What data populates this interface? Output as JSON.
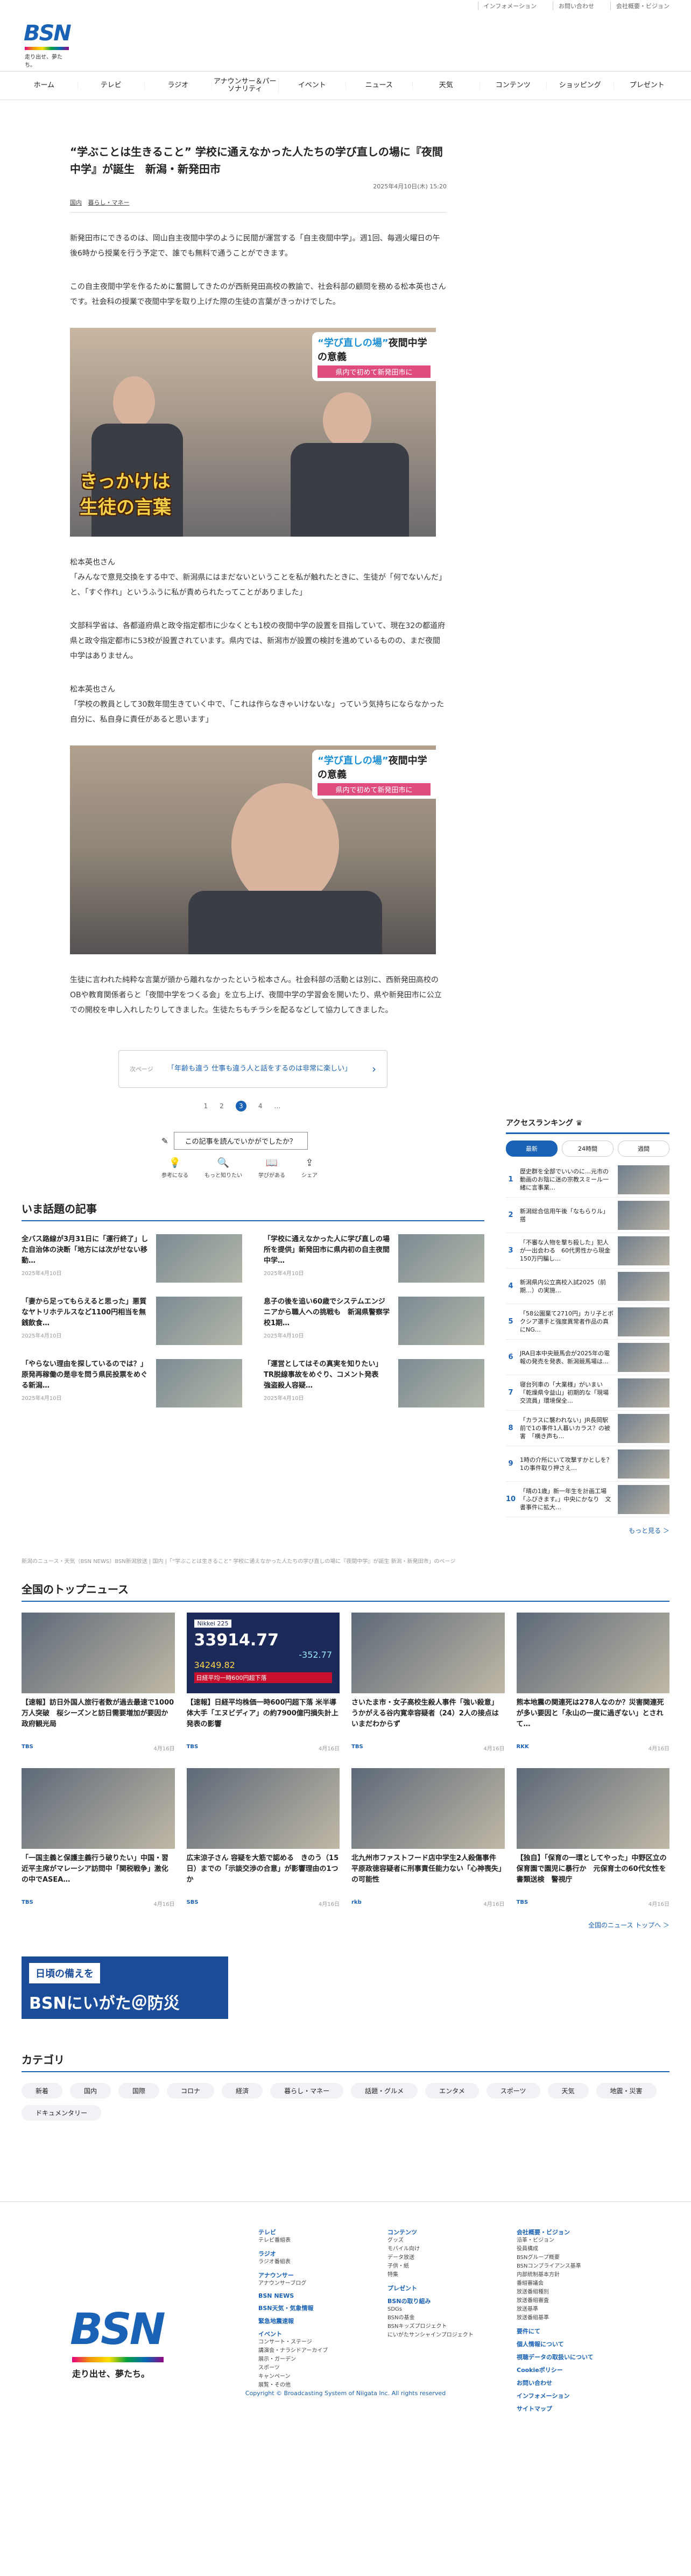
{
  "utility": [
    "インフォメーション",
    "お問い合わせ",
    "会社概要・ビジョン"
  ],
  "logo": {
    "text": "BSN",
    "tagline": "走り出せ、夢たち。"
  },
  "nav": [
    "ホーム",
    "テレビ",
    "ラジオ",
    "アナウンサー＆パーソナリティ",
    "イベント",
    "ニュース",
    "天気",
    "コンテンツ",
    "ショッピング",
    "プレゼント"
  ],
  "article": {
    "title": "“学ぶことは生きること” 学校に通えなかった人たちの学び直しの場に『夜間中学』が誕生　新潟・新発田市",
    "date": "2025年4月10日(木) 15:20",
    "tags": [
      "国内",
      "暮らし・マネー"
    ],
    "p1": "新発田市にできるのは、岡山自主夜間中学のように民間が運営する「自主夜間中学」。週1回、毎週火曜日の午後6時から授業を行う予定で、誰でも無料で通うことができます。",
    "p2": "この自主夜間中学を作るために奮闘してきたのが西新発田高校の教諭で、社会科部の顧問を務める松本英也さんです。社会科の授業で夜間中学を取り上げた際の生徒の言葉がきっかけでした。",
    "photo1": {
      "main_a": "“学び直しの場”",
      "main_b": "夜間中学の意義",
      "sub": "県内で初めて新発田市に",
      "big_a": "きっかけは",
      "big_b": "生徒の言葉"
    },
    "speaker1": "松本英也さん",
    "q1": "「みんなで意見交換をする中で、新潟県にはまだないということを私が触れたときに、生徒が「何でないんだ」と、「すぐ作れ」というふうに私が責められたってことがありました」",
    "p3": "文部科学省は、各都道府県と政令指定都市に少なくとも1校の夜間中学の設置を目指していて、現在32の都道府県と政令指定都市に53校が設置されています。県内では、新潟市が設置の検討を進めているものの、まだ夜間中学はありません。",
    "speaker2": "松本英也さん",
    "q2": "「学校の教員として30数年間生きていく中で、「これは作らなきゃいけないな」っていう気持ちにならなかった自分に、私自身に責任があると思います」",
    "photo2": {
      "main_a": "“学び直しの場”",
      "main_b": "夜間中学の意義",
      "sub": "県内で初めて新発田市に"
    },
    "p4": "生徒に言われた純粋な言葉が頭から離れなかったという松本さん。社会科部の活動とは別に、西新発田高校のOBや教育関係者らと「夜間中学をつくる会」を立ち上げ、夜間中学の学習会を開いたり、県や新発田市に公立での開校を申し入れしたりしてきました。生徒たちもチラシを配るなどして協力してきました。"
  },
  "next": {
    "label": "次ページ",
    "text": "「年齢も違う 仕事も違う人と話をするのは非常に楽しい」"
  },
  "pager": [
    "1",
    "2",
    "3",
    "4",
    "…"
  ],
  "pager_current": "3",
  "survey": {
    "question": "この記事を読んでいかがでしたか？",
    "options": [
      "参考になる",
      "もっと知りたい",
      "学びがある",
      "シェア"
    ]
  },
  "hot": {
    "title": "いま話題の記事",
    "items": [
      {
        "t": "全バス路線が3月31日に「運行終了」した自治体の決断「地方には次がせない移動…",
        "d": "2025年4月10日"
      },
      {
        "t": "「学校に通えなかった人に学び直しの場所を提供」新発田市に県内初の自主夜間中学…",
        "d": "2025年4月10日"
      },
      {
        "t": "「妻から足ってもらえると思った」悪質なヤトリホテルスなど1100円相当を無銭飲食…",
        "d": "2025年4月10日"
      },
      {
        "t": "息子の後を追い60歳でシステムエンジニアから職人への挑戦も　新潟県警察学校1期…",
        "d": "2025年4月10日"
      },
      {
        "t": "「やらない理由を探しているのでは？」原発再稼働の是非を問う県民投票をめぐる新潟…",
        "d": "2025年4月10日"
      },
      {
        "t": "「運営としてはその真実を知りたい」TR脱線事故をめぐり、コメント発表　強盗殺人容疑…",
        "d": "2025年4月10日"
      }
    ]
  },
  "ranking": {
    "title": "アクセスランキング",
    "tabs": [
      "最新",
      "24時間",
      "週間"
    ],
    "items": [
      {
        "no": "1",
        "t": "歴史群を全部でいいのに…元市の動画のお陰に迷の宗教スミール一緒に言事業…"
      },
      {
        "no": "2",
        "t": "新潟総合信用午後「なもらりル」搭"
      },
      {
        "no": "3",
        "t": "「不審な人物を撃ち殺した」犯人が一出会わる　60代男性から現金150万円騙し…"
      },
      {
        "no": "4",
        "t": "新潟県内公立高校入試2025（前期…）の実施…"
      },
      {
        "no": "5",
        "t": "「58公園棄て2710円」カリ子とボクシア選手と強度異常者作品の真にNG…"
      },
      {
        "no": "6",
        "t": "JRA日本中央競馬会が2025年の電報の発売を発表、新潟競馬場は…"
      },
      {
        "no": "7",
        "t": "寝台列車の「大業様」がいまい「乾燥県令益山」初期的な「現場交流員」環境保全…"
      },
      {
        "no": "8",
        "t": "「カラスに襲われない」JR長岡駅前で1の事件1人暮いカラス？の被害　「横き声も…"
      },
      {
        "no": "9",
        "t": "1時の介所にいて攻撃すかとしを？1の事件取り押さえ…"
      },
      {
        "no": "10",
        "t": "「晴の1歳」新一年生を計画工場「ふびきます。」中央にかなり　文書事件に拡大…"
      }
    ],
    "more": "もっと見る ＞"
  },
  "breadcrumb": "新潟のニュース・天気（BSN NEWS）BSN新潟放送 | 国内 |「“学ぶことは生きること” 学校に通えなかった人たちの学び直しの場に『夜間中学』が誕生 新潟・新発田市」のページ",
  "national": {
    "title": "全国のトップニュース",
    "items": [
      {
        "t": "【速報】訪日外国人旅行者数が過去最速で1000万人突破　桜シーズンと訪日需要増加が要因か　政府観光局",
        "src": "TBS",
        "d": "4月16日"
      },
      {
        "t": "【速報】日経平均株価一時600円超下落 米半導体大手「エヌビディア」の約7900億円損失計上発表の影響",
        "src": "TBS",
        "d": "4月16日"
      },
      {
        "t": "さいたま市・女子高校生殺人事件「強い殺意」うかがえる谷内寛幸容疑者（24）2人の接点はいまだわからず",
        "src": "TBS",
        "d": "4月16日"
      },
      {
        "t": "熊本地震の関連死は278人なのか？災害関連死が多い要因と「永山の一度に過ぎない」とされて…",
        "src": "RKK",
        "d": "4月16日"
      },
      {
        "t": "「一国主義と保護主義行う破りたい」中国・習近平主席がマレーシア訪問中「関税戦争」激化の中でASEA…",
        "src": "TBS",
        "d": "4月16日"
      },
      {
        "t": "広末涼子さん 容疑を大筋で認める　きのう（15日）までの「示談交渉の合意」が影響理由の1つか",
        "src": "SBS",
        "d": "4月16日"
      },
      {
        "t": "北九州市ファストフード店中学生2人殺傷事件　平原政徳容疑者に刑事責任能力ない「心神喪失」の可能性",
        "src": "rkb",
        "d": "4月16日"
      },
      {
        "t": "【独自】「保育の一環としてやった」中野区立の保育園で園児に暴行か　元保育士の60代女性を書類送検　警視庁",
        "src": "TBS",
        "d": "4月16日"
      }
    ],
    "photo_labels": [
      "",
      "Nikkei 225",
      "",
      ""
    ],
    "nikkei": {
      "value": "33914.77",
      "change": "-352.77",
      "low": "34249.82",
      "ticker": "日経平均一時600円超下落"
    },
    "more": "全国のニュース トップへ ＞"
  },
  "banner": {
    "line1": "日頃の備えを",
    "line2": "BSNにいがた＠防災"
  },
  "categories": {
    "title": "カテゴリ",
    "items": [
      "新着",
      "国内",
      "国際",
      "コロナ",
      "経済",
      "暮らし・マネー",
      "話題・グルメ",
      "エンタメ",
      "スポーツ",
      "天気",
      "地震・災害",
      "ドキュメンタリー"
    ]
  },
  "footer": {
    "cols": [
      [
        {
          "h": "テレビ",
          "l": [
            "テレビ番組表"
          ]
        },
        {
          "h": "ラジオ",
          "l": [
            "ラジオ番組表"
          ]
        },
        {
          "h": "アナウンサー",
          "l": [
            "アナウンサーブログ"
          ]
        },
        {
          "h": "BSN NEWS",
          "l": []
        },
        {
          "h": "BSN天気・気象情報",
          "l": []
        },
        {
          "h": "緊急地震速報",
          "l": []
        },
        {
          "h": "イベント",
          "l": [
            "コンサート・ステージ",
            "講演会・ナラシドアーカイブ",
            "展示・ガーデン",
            "スポーツ",
            "キャンペーン",
            "展覧・その他"
          ]
        }
      ],
      [
        {
          "h": "コンテンツ",
          "l": [
            "グッズ",
            "モバイル向け",
            "データ放送",
            "子供・紙",
            "特集"
          ]
        },
        {
          "h": "プレゼント",
          "l": []
        },
        {
          "h": "BSNの取り組み",
          "l": [
            "SDGs",
            "BSNの基金",
            "BSNキッズプロジェクト",
            "にいがたサンシャインプロジェクト"
          ]
        }
      ],
      [
        {
          "h": "会社概要・ビジョン",
          "l": [
            "沿革・ビジョン",
            "役員構成",
            "BSNグループ概要",
            "BSNコンプライアンス基準",
            "内部統制基本方針",
            "番組審議会",
            "放送番組種別",
            "放送番組審査",
            "放送基準",
            "放送番組基準"
          ]
        },
        {
          "h": "要件にて",
          "l": []
        },
        {
          "h": "個人情報について",
          "l": []
        },
        {
          "h": "視聴データの取扱いについて",
          "l": []
        },
        {
          "h": "Cookieポリシー",
          "l": []
        },
        {
          "h": "お問い合わせ",
          "l": []
        },
        {
          "h": "インフォメーション",
          "l": []
        },
        {
          "h": "サイトマップ",
          "l": []
        }
      ]
    ],
    "copyright": "Copyright © Broadcasting System of Niigata Inc. All rights reserved"
  }
}
